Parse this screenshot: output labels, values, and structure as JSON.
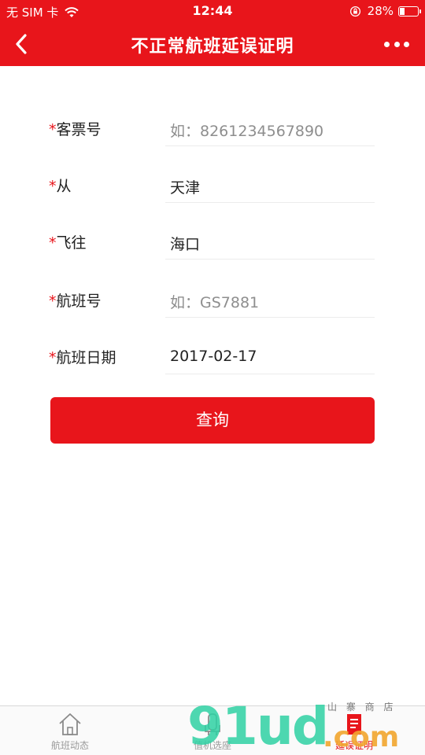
{
  "status": {
    "carrier": "无 SIM 卡",
    "time": "12:44",
    "battery": "28%",
    "battery_level": 0.28
  },
  "header": {
    "title": "不正常航班延误证明"
  },
  "form": {
    "required_mark": "*",
    "ticket": {
      "label": "客票号",
      "placeholder": "如：8261234567890"
    },
    "from": {
      "label": "从",
      "value": "天津"
    },
    "to": {
      "label": "飞往",
      "value": "海口"
    },
    "flight": {
      "label": "航班号",
      "placeholder": "如：GS7881"
    },
    "date": {
      "label": "航班日期",
      "value": "2017-02-17"
    }
  },
  "search_button": {
    "label": "查询"
  },
  "tabbar": {
    "items": [
      {
        "label": "航班动态",
        "icon": "home-icon",
        "active": false
      },
      {
        "label": "值机选座",
        "icon": "seat-icon",
        "active": false
      },
      {
        "label": "延误证明",
        "icon": "document-icon",
        "active": true
      }
    ]
  },
  "watermark": {
    "main": "91ud",
    "suffix": ".com",
    "top": "山 寨 商 店"
  },
  "colors": {
    "brand": "#e8151b"
  }
}
